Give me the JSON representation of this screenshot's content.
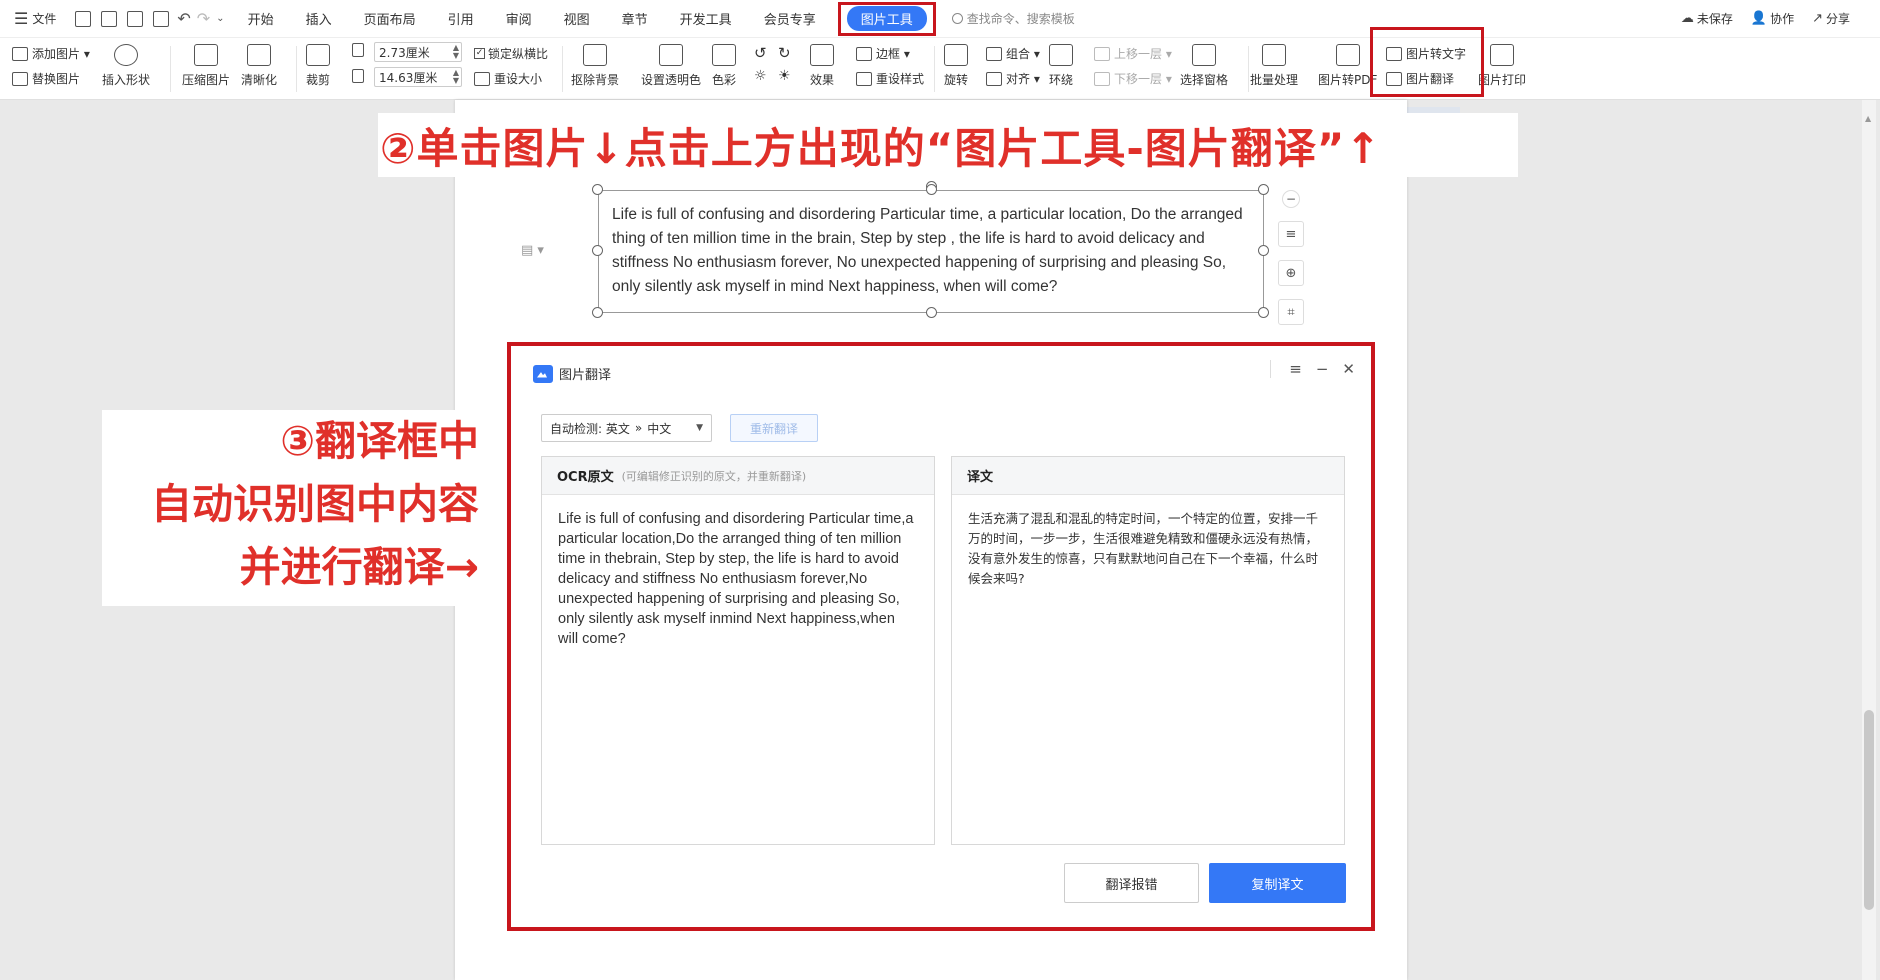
{
  "menubar": {
    "file_label": "文件",
    "tabs": [
      "开始",
      "插入",
      "页面布局",
      "引用",
      "审阅",
      "视图",
      "章节",
      "开发工具",
      "会员专享"
    ],
    "active_tab": "图片工具",
    "search_placeholder": "查找命令、搜索模板",
    "unsaved_label": "未保存",
    "collab_label": "协作",
    "share_label": "分享"
  },
  "ribbon": {
    "add_picture": "添加图片",
    "replace_picture": "替换图片",
    "insert_shape": "插入形状",
    "compress_picture": "压缩图片",
    "sharpen": "清晰化",
    "crop": "裁剪",
    "height_value": "2.73厘米",
    "width_value": "14.63厘米",
    "lock_ratio": "锁定纵横比",
    "reset_size": "重设大小",
    "remove_bg": "抠除背景",
    "set_transparent": "设置透明色",
    "color": "色彩",
    "effects": "效果",
    "border": "边框",
    "reset_style": "重设样式",
    "rotate": "旋转",
    "group": "组合",
    "align": "对齐",
    "wrap": "环绕",
    "bring_forward": "上移一层",
    "send_backward": "下移一层",
    "selection_pane": "选择窗格",
    "batch_process": "批量处理",
    "picture_to_pdf": "图片转PDF",
    "picture_to_text": "图片转文字",
    "picture_translate": "图片翻译",
    "picture_print": "图片打印"
  },
  "banner_text": "②单击图片↓点击上方出现的“图片工具-图片翻译”↑",
  "picture_text": "Life is full of confusing and disordering Particular time, a particular location, Do the arranged thing of ten million time in the brain, Step by step , the life is hard to avoid delicacy and stiffness No enthusiasm forever, No unexpected happening of surprising and pleasing So, only silently ask myself in mind Next happiness, when will come?",
  "left_note": {
    "line1": "③翻译框中",
    "line2": "自动识别图中内容",
    "line3": "并进行翻译→"
  },
  "dialog": {
    "title": "图片翻译",
    "lang_auto": "自动检测: 英文",
    "lang_sep": "»",
    "lang_target": "中文",
    "retranslate": "重新翻译",
    "ocr_header": "OCR原文",
    "ocr_hint": "(可编辑修正识别的原文，并重新翻译)",
    "ocr_text": "Life is full of confusing and disordering Particular time,a particular location,Do the arranged thing of ten million time in thebrain, Step by step, the life is hard to avoid delicacy and stiffness No enthusiasm forever,No unexpected happening of surprising and pleasing So, only silently ask myself inmind Next happiness,when will come?",
    "trans_header": "译文",
    "trans_text": "生活充满了混乱和混乱的特定时间，一个特定的位置，安排一千万的时间，一步一步，生活很难避免精致和僵硬永远没有热情，没有意外发生的惊喜，只有默默地问自己在下一个幸福，什么时候会来吗?",
    "report_button": "翻译报错",
    "copy_button": "复制译文"
  },
  "colors": {
    "accent_blue": "#3478f6",
    "annotation_red": "#e0302a",
    "highlight_box": "#c8161d"
  }
}
